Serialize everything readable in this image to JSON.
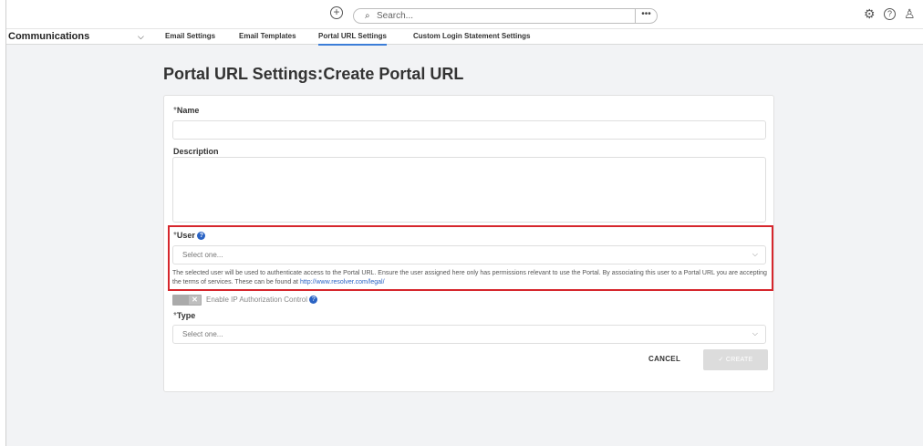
{
  "topbar": {
    "plus_icon": "⊕",
    "search_placeholder": "Search...",
    "search_icon": "⚲",
    "more_label": "•••",
    "icons": {
      "settings": "⚙",
      "help": "?",
      "user": "♙"
    }
  },
  "nav": {
    "title": "Communications",
    "chevron": "⌄",
    "tabs": [
      {
        "label": "Email Settings"
      },
      {
        "label": "Email Templates"
      },
      {
        "label": "Portal URL Settings"
      },
      {
        "label": "Custom Login Statement Settings"
      }
    ],
    "active_tab": "Portal URL Settings"
  },
  "page": {
    "title": "Portal URL Settings",
    "separator": ":",
    "subtitle": "Create Portal URL"
  },
  "form": {
    "required_mark": "*",
    "name_label": "Name",
    "description_label": "Description",
    "user_label": "User",
    "user_placeholder": "Select one...",
    "user_help": "The selected user will be used to authenticate access to the Portal URL. Ensure the user assigned here only has permissions relevant to use the Portal. By associating this user to a Portal URL you are accepting the terms of services. These can be found at",
    "user_help_link": "http://www.resolver.com/legal/",
    "ip_toggle_label": "Enable IP Authorization Control",
    "type_label": "Type",
    "type_placeholder": "Select one...",
    "cancel_label": "CANCEL",
    "create_label": "✓ CREATE"
  },
  "colors": {
    "accent": "#3b7dd8",
    "highlight": "#d6262c",
    "help_icon": "#2a63c4"
  }
}
